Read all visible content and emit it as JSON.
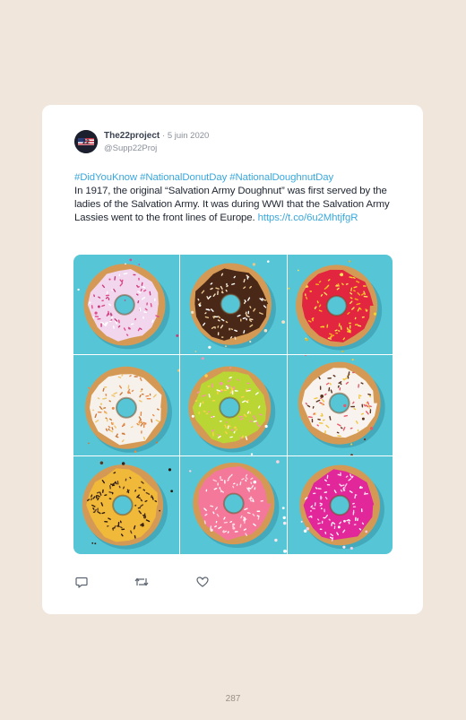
{
  "tweet": {
    "author_name": "The22project",
    "date": "· 5 juin 2020",
    "handle": "@Supp22Proj",
    "hashtags": [
      "#DidYouKnow",
      "#NationalDonutDay",
      "#NationalDoughnutDay"
    ],
    "body": "In 1917, the original “Salvation Army Doughnut” was first served by the ladies of the Salvation Army. It was during WWI that the Salvation Army Lassies went to the front lines of Europe.",
    "link": "https://t.co/6u2MhtjfgR"
  },
  "image": {
    "donuts": [
      {
        "glaze": "#f1d6ee",
        "sprinkles": [
          "#e04c8a",
          "#ffffff",
          "#c93c7c"
        ]
      },
      {
        "glaze": "#4a2818",
        "sprinkles": [
          "#f5e2c4",
          "#e8c68a",
          "#ffffff"
        ]
      },
      {
        "glaze": "#e3263f",
        "sprinkles": [
          "#f7d42a",
          "#f2b31a",
          "#ffe45c"
        ]
      },
      {
        "glaze": "#f6f1ea",
        "sprinkles": [
          "#e88a4a",
          "#f0c46a",
          "#c9793a"
        ]
      },
      {
        "glaze": "#b9d634",
        "sprinkles": [
          "#ff8fb0",
          "#ffffff",
          "#ffd14a"
        ]
      },
      {
        "glaze": "#f8f3ee",
        "sprinkles": [
          "#5b3320",
          "#e85a6a",
          "#f2c53a"
        ]
      },
      {
        "glaze": "#f0b93a",
        "sprinkles": [
          "#3a2214",
          "#5a3a24",
          "#2a180e"
        ]
      },
      {
        "glaze": "#f3789a",
        "sprinkles": [
          "#ffffff",
          "#fde6ee",
          "#ffd3e0"
        ]
      },
      {
        "glaze": "#e2279a",
        "sprinkles": [
          "#ffffff",
          "#ffe2f3",
          "#f9c9e6"
        ]
      }
    ],
    "background": "#56c6d6",
    "dough": "#d49a55"
  },
  "actions": {
    "reply_icon": "reply-icon",
    "retweet_icon": "retweet-icon",
    "like_icon": "heart-icon"
  },
  "page_number": "287",
  "colors": {
    "page_bg": "#f1e6dc",
    "link": "#3aa8dc",
    "text": "#1e2430"
  }
}
